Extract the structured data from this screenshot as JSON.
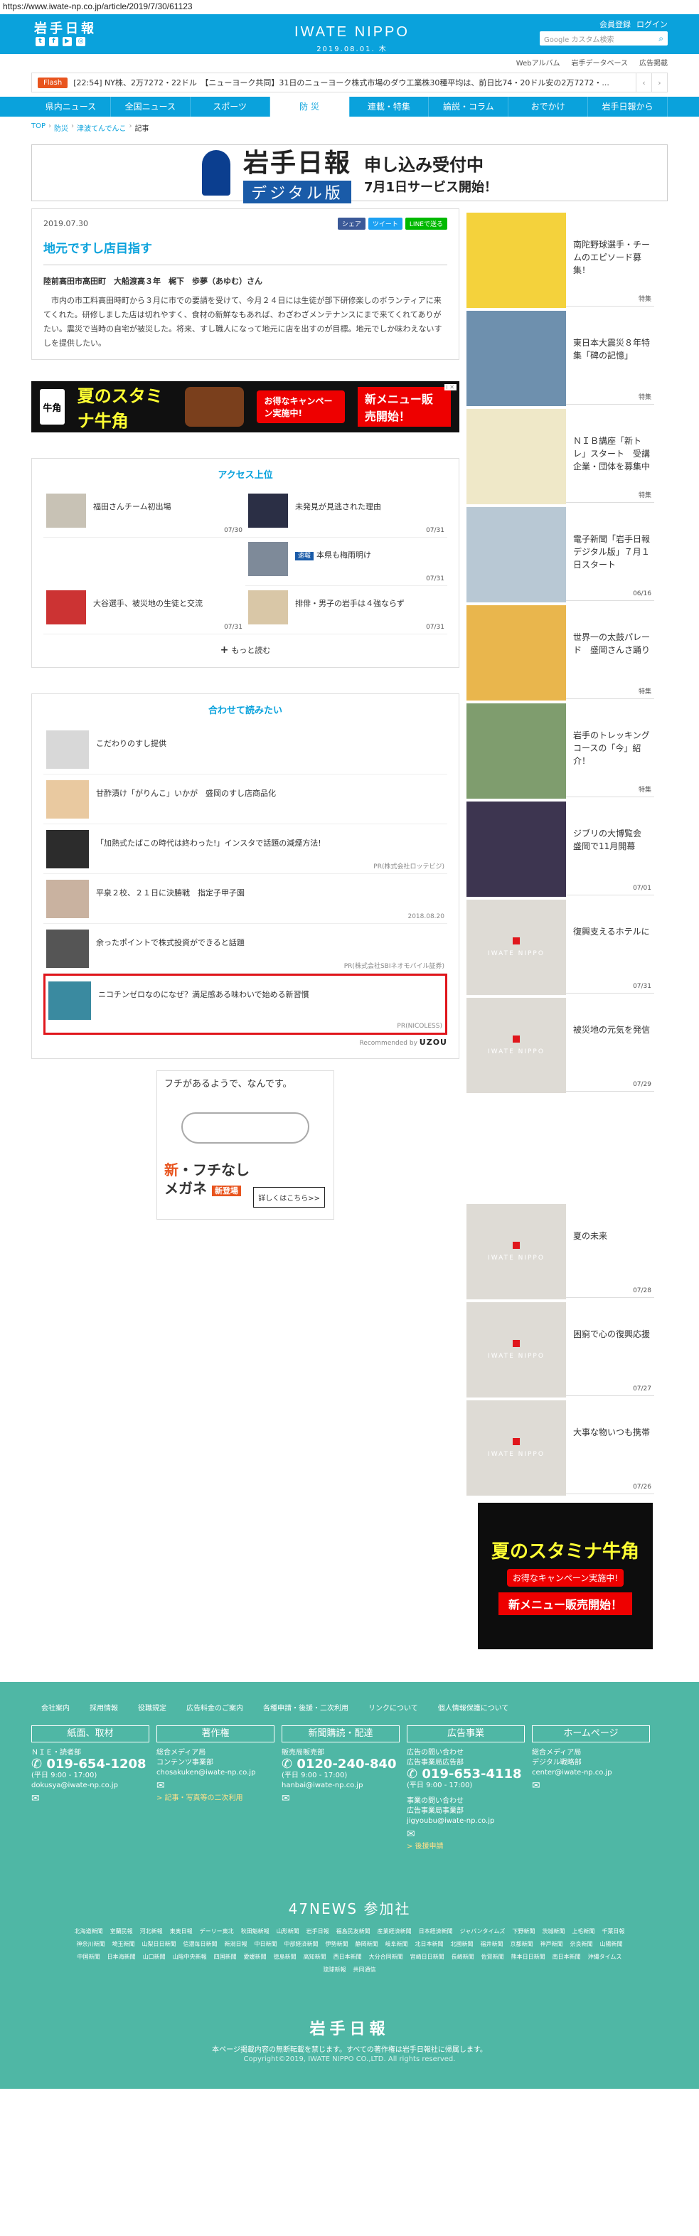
{
  "browser": {
    "url": "https://www.iwate-np.co.jp/article/2019/7/30/61123"
  },
  "header": {
    "logo": "岩手日報",
    "brand": "IWATE NIPPO",
    "date": "2019.08.01. 木",
    "member_register": "会員登録",
    "login": "ログイン",
    "search_placeholder": "Google カスタム検索"
  },
  "subnav": [
    "Webアルバム",
    "岩手データベース",
    "広告掲載"
  ],
  "flash": {
    "tag": "Flash",
    "text": "[22:54] NY株、2万7272・22ドル　【ニューヨーク共同】31日のニューヨーク株式市場のダウ工業株30種平均は、前日比74・20ドル安の2万7272・..."
  },
  "mainnav": [
    "県内ニュース",
    "全国ニュース",
    "スポーツ",
    "防 災",
    "連載・特集",
    "論説・コラム",
    "おでかけ",
    "岩手日報から"
  ],
  "mainnav_active": 3,
  "breadcrumb": [
    "TOP",
    "防災",
    "津波てんでんこ",
    "記事"
  ],
  "banner": {
    "logo": "岩手日報",
    "sub": "デジタル版",
    "line1": "申し込み受付中",
    "line2": "7月1日サービス開始！"
  },
  "article": {
    "date": "2019.07.30",
    "share_fb": "シェア",
    "share_tw": "ツイート",
    "share_line": "LINEで送る",
    "title": "地元ですし店目指す",
    "byline": "陸前高田市高田町　大船渡高３年　梶下　歩夢（あゆむ）さん",
    "body": "市内の市工料高田時町から３月に市での要請を受けて、今月２４日には生徒が部下研修楽しのボランティアに来てくれた。研修しました店は切れやすく、食材の新鮮なもあれば、わざわざメンテナンスにまで来てくれてありがたい。震災で当時の自宅が被災した。将来、すし職人になって地元に店を出すのが目標。地元でしか味わえないすしを提供したい。"
  },
  "ad_wide": {
    "logo": "牛角",
    "title": "夏のスタミナ牛角",
    "campaign": "お得なキャンペーン実施中!",
    "new": "新メニュー販売開始！",
    "info": "i ✕"
  },
  "ranking": {
    "title": "アクセス上位",
    "items": [
      {
        "text": "福田さんチーム初出場",
        "date": "07/30"
      },
      {
        "text": "未発見が見逃された理由",
        "date": "07/31"
      },
      {
        "text": "",
        "date": ""
      },
      {
        "tag": "速報",
        "text": "本県も梅雨明け",
        "date": "07/31"
      },
      {
        "text": "大谷選手、被災地の生徒と交流",
        "date": "07/31"
      },
      {
        "text": "排俳・男子の岩手は４強ならず",
        "date": "07/31"
      }
    ],
    "more": "もっと読む"
  },
  "recommend": {
    "title": "合わせて読みたい",
    "items": [
      {
        "text": "こだわりのすし提供",
        "meta": ""
      },
      {
        "text": "甘酢漬け「がりんこ」いかが　盛岡のすし店商品化",
        "meta": ""
      },
      {
        "text": "「加熱式たばこの時代は終わった!」インスタで話題の減煙方法!",
        "meta": "PR(株式会社ロッテビジ)"
      },
      {
        "text": "平泉２校、２１日に決勝戦　指定子甲子園",
        "meta": "2018.08.20"
      },
      {
        "text": "余ったポイントで株式投資ができると話題",
        "meta": "PR(株式会社SBIネオモバイル証券)"
      },
      {
        "text": "ニコチンゼロなのになぜ？満足感ある味わいで始める新習慣",
        "meta": "PR(NICOLESS)"
      }
    ],
    "footer_label": "Recommended by",
    "footer_brand": "UZOU"
  },
  "ad_square": {
    "question": "フチがあるようで、なんです。",
    "copy_new": "新",
    "copy_line1": "・フチなし",
    "copy_line2": "メガネ",
    "badge": "新登場",
    "button": "詳しくはこちら>>"
  },
  "sidebar": [
    {
      "text": "南陀野球選手・チームのエピソード募集！",
      "date": "特集"
    },
    {
      "text": "東日本大震災８年特集「碑の記憶」",
      "date": "特集"
    },
    {
      "text": "ＮＩＢ講座「新トレ」スタート　受講企業・団体を募集中",
      "date": "特集"
    },
    {
      "text": "電子新聞「岩手日報デジタル版」７月１日スタート",
      "date": "06/16"
    },
    {
      "text": "世界一の太鼓パレード　盛岡さんさ踊り",
      "date": "特集"
    },
    {
      "text": "岩手のトレッキングコースの「今」紹介！",
      "date": "特集"
    },
    {
      "text": "ジブリの大博覧会　盛岡で11月開幕",
      "date": "07/01"
    },
    {
      "text": "復興支えるホテルに",
      "date": "07/31"
    },
    {
      "text": "被災地の元気を発信",
      "date": "07/29"
    },
    {
      "text": "夏の未来",
      "date": "07/28"
    },
    {
      "text": "困窮で心の復興応援",
      "date": "07/27"
    },
    {
      "text": "大事な物いつも携帯",
      "date": "07/26"
    }
  ],
  "placeholder_label": "IWATE NIPPO",
  "side_ad": {
    "title": "夏のスタミナ牛角",
    "campaign": "お得なキャンペーン実施中!",
    "new": "新メニュー販売開始！"
  },
  "footer": {
    "links": [
      "会社案内",
      "採用情報",
      "役職規定",
      "広告料金のご案内",
      "各種申請・後援・二次利用",
      "リンクについて",
      "個人情報保護について"
    ],
    "cols": [
      {
        "head": "紙面、取材",
        "line1": "ＮＩＥ・読者部",
        "phone": "019-654-1208",
        "hours": "(平日 9:00 - 17:00)",
        "email": "dokusya@iwate-np.co.jp",
        "link": ""
      },
      {
        "head": "著作権",
        "line1": "総合メディア局",
        "line2": "コンテンツ事業部",
        "email": "chosakuken@iwate-np.co.jp",
        "link": "> 記事・写真等の二次利用"
      },
      {
        "head": "新聞購読・配達",
        "line1": "販売局販売部",
        "phone": "0120-240-840",
        "hours": "(平日 9:00 - 17:00)",
        "email": "hanbai@iwate-np.co.jp",
        "link": ""
      },
      {
        "head": "広告事業",
        "line1": "広告の問い合わせ",
        "line2": "広告事業局広告部",
        "phone": "019-653-4118",
        "hours": "(平日 9:00 - 17:00)",
        "line3": "事業の問い合わせ",
        "line4": "広告事業局事業部",
        "email": "jigyoubu@iwate-np.co.jp",
        "link": "> 後援申請"
      },
      {
        "head": "ホームページ",
        "line1": "総合メディア局",
        "line2": "デジタル戦略部",
        "email": "center@iwate-np.co.jp",
        "link": ""
      }
    ],
    "news47": "47NEWS 参加社",
    "papers": [
      "北海道新聞",
      "室蘭民報",
      "河北新報",
      "東奥日報",
      "デーリー東北",
      "秋田魁新報",
      "山形新聞",
      "岩手日報",
      "福島民友新聞",
      "産業経済新聞",
      "日本経済新聞",
      "ジャパンタイムズ",
      "下野新聞",
      "茨城新聞",
      "上毛新聞",
      "千葉日報",
      "神奈川新聞",
      "埼玉新聞",
      "山梨日日新聞",
      "信濃毎日新聞",
      "新潟日報",
      "中日新聞",
      "中部経済新聞",
      "伊勢新聞",
      "静岡新聞",
      "岐阜新聞",
      "北日本新聞",
      "北國新聞",
      "福井新聞",
      "京都新聞",
      "神戸新聞",
      "奈良新聞",
      "山陽新聞",
      "中国新聞",
      "日本海新聞",
      "山口新聞",
      "山陰中央新報",
      "四国新聞",
      "愛媛新聞",
      "徳島新聞",
      "高知新聞",
      "西日本新聞",
      "大分合同新聞",
      "宮崎日日新聞",
      "長崎新聞",
      "佐賀新聞",
      "熊本日日新聞",
      "南日本新聞",
      "沖縄タイムス",
      "琉球新報",
      "共同通信"
    ],
    "logo": "岩手日報",
    "note": "本ページ掲載内容の無断転載を禁じます。すべての著作権は岩手日報社に帰属します。",
    "copyright": "Copyright©2019, IWATE NIPPO CO.,LTD. All rights reserved."
  },
  "colors": {
    "brand": "#0aa2dc",
    "footer": "#4fb7a5",
    "highlight": "#e0161c"
  }
}
